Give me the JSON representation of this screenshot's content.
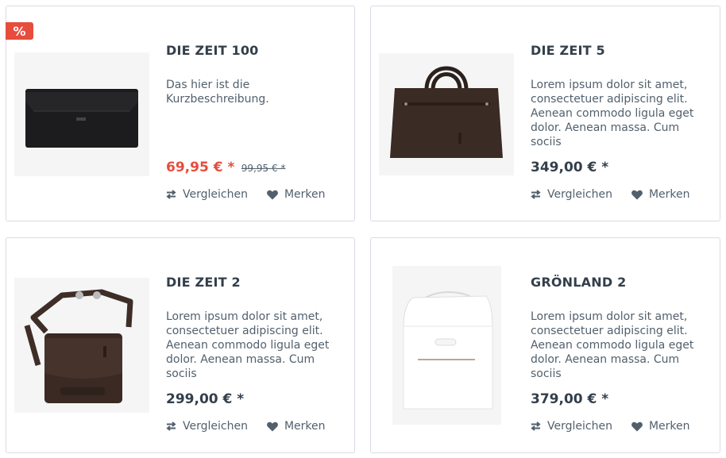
{
  "products": [
    {
      "name": "DIE ZEIT 100",
      "description": "Das hier ist die Kurzbeschreibung.",
      "price": "69,95 € *",
      "old_price": "99,95 € *",
      "badge": "%",
      "compare_label": "Vergleichen",
      "wishlist_label": "Merken"
    },
    {
      "name": "DIE ZEIT 5",
      "description": "Lorem ipsum dolor sit amet, consectetuer adipiscing elit. Aenean commodo ligula eget dolor. Aenean massa. Cum sociis",
      "price": "349,00 € *",
      "compare_label": "Vergleichen",
      "wishlist_label": "Merken"
    },
    {
      "name": "DIE ZEIT 2",
      "description": "Lorem ipsum dolor sit amet, consectetuer adipiscing elit. Aenean commodo ligula eget dolor. Aenean massa. Cum sociis",
      "price": "299,00 € *",
      "compare_label": "Vergleichen",
      "wishlist_label": "Merken"
    },
    {
      "name": "GRÖNLAND 2",
      "description": "Lorem ipsum dolor sit amet, consectetuer adipiscing elit. Aenean commodo ligula eget dolor. Aenean massa. Cum sociis",
      "price": "379,00 € *",
      "compare_label": "Vergleichen",
      "wishlist_label": "Merken"
    }
  ],
  "colors": {
    "sale": "#e74c3c",
    "text": "#52606d",
    "heading": "#333f4b",
    "border": "#dadae5"
  },
  "icons": {
    "compare": "compare-arrows-icon",
    "wishlist": "heart-icon"
  }
}
